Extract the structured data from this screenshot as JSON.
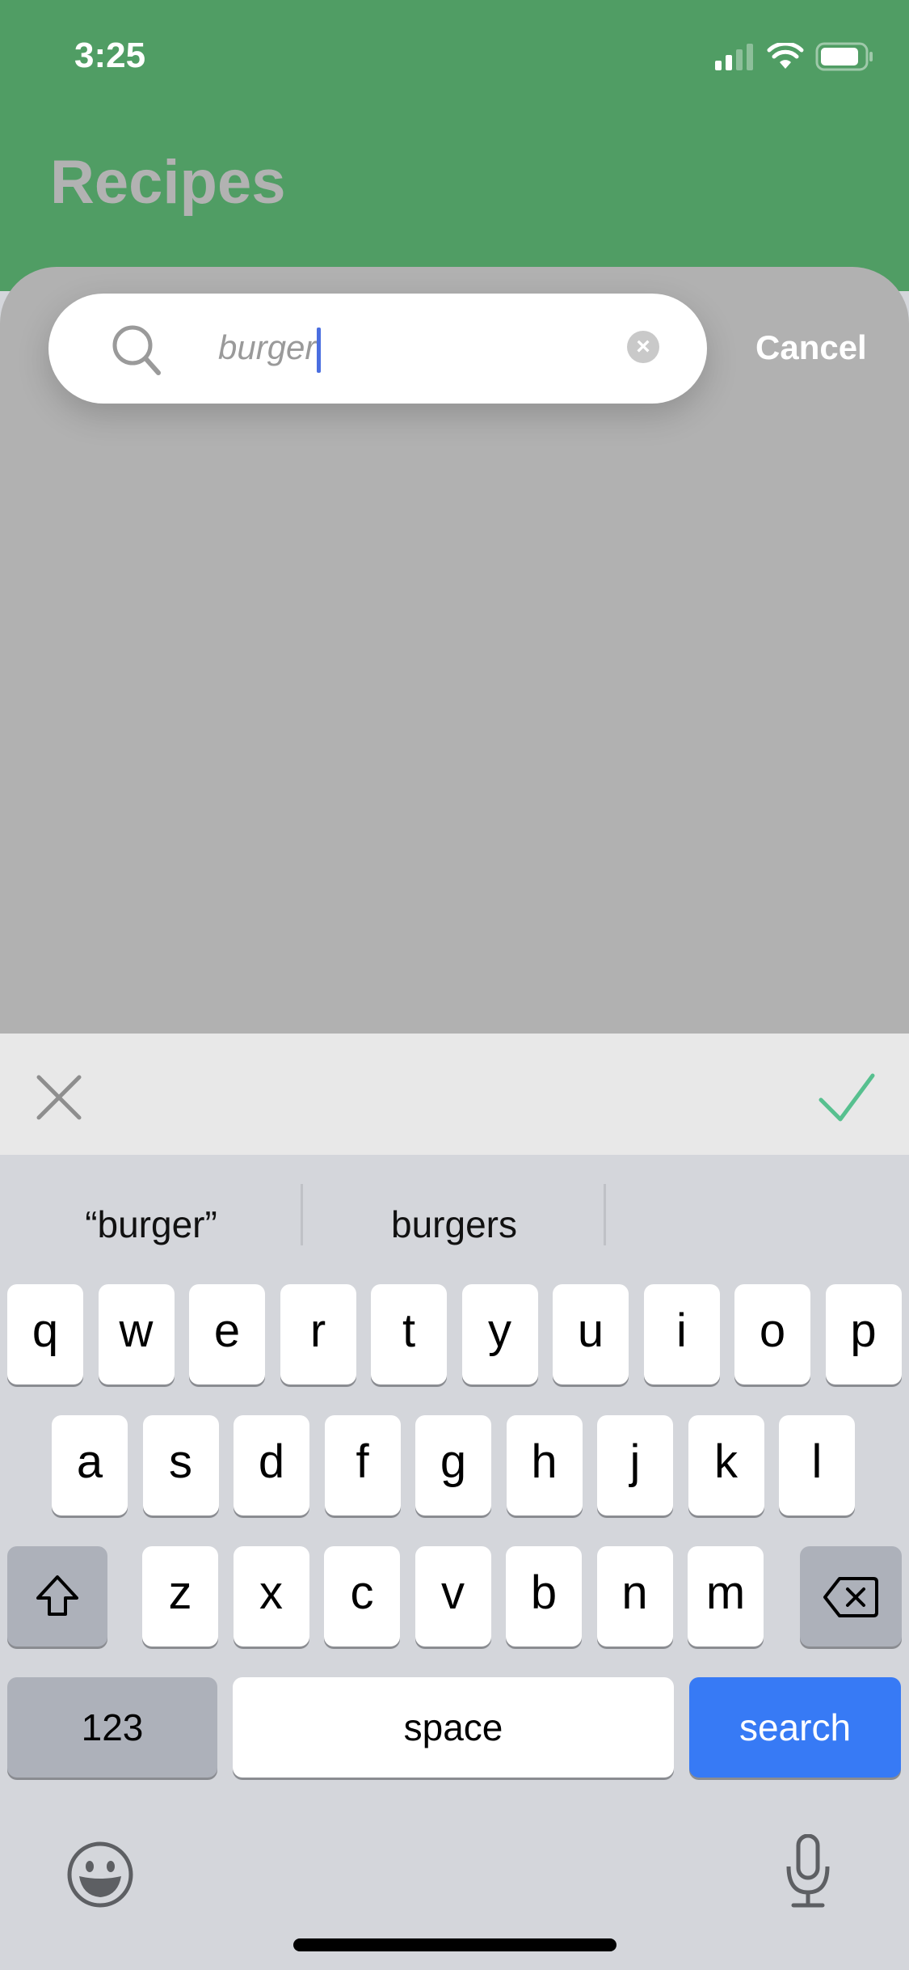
{
  "status_bar": {
    "time": "3:25",
    "signal_icon": "cellular-signal-icon",
    "wifi_icon": "wifi-icon",
    "battery_icon": "battery-icon"
  },
  "header": {
    "title": "Recipes",
    "background_color": "#509d64"
  },
  "search": {
    "value": "burger",
    "search_icon": "magnifier-icon",
    "clear_icon": "clear-circle-icon",
    "cancel_label": "Cancel"
  },
  "input_toolbar": {
    "dismiss_icon": "close-x-icon",
    "confirm_icon": "checkmark-icon",
    "confirm_color": "#57c08f"
  },
  "keyboard": {
    "predictions": [
      "“burger”",
      "burgers",
      ""
    ],
    "row1": [
      "q",
      "w",
      "e",
      "r",
      "t",
      "y",
      "u",
      "i",
      "o",
      "p"
    ],
    "row2": [
      "a",
      "s",
      "d",
      "f",
      "g",
      "h",
      "j",
      "k",
      "l"
    ],
    "row3": [
      "z",
      "x",
      "c",
      "v",
      "b",
      "n",
      "m"
    ],
    "shift_icon": "shift-arrow-icon",
    "backspace_icon": "backspace-icon",
    "numbers_label": "123",
    "space_label": "space",
    "return_label": "search",
    "return_color": "#377af5",
    "emoji_icon": "emoji-icon",
    "mic_icon": "microphone-icon"
  }
}
